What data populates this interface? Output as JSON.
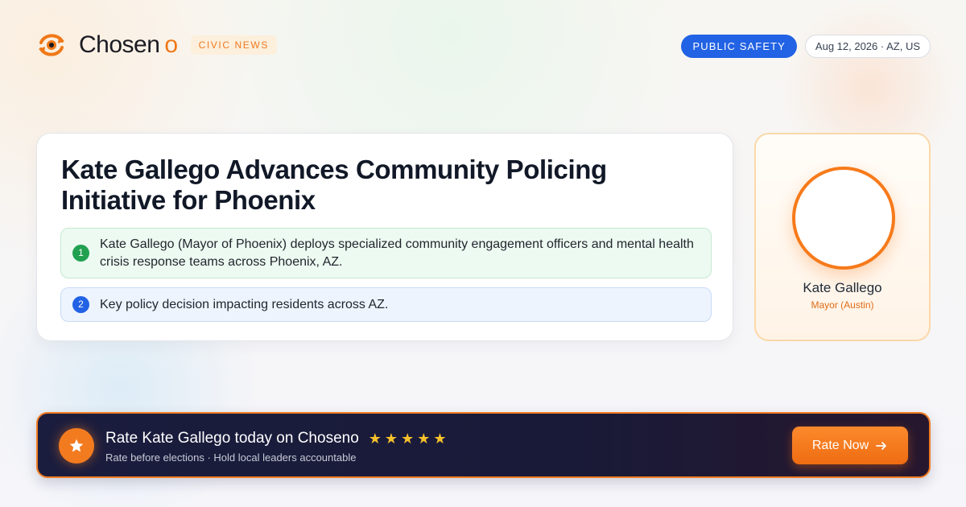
{
  "brand": {
    "name": "Chosen",
    "name_suffix": "o",
    "tag": "CIVIC NEWS",
    "logo_icon": "eye-refresh-icon"
  },
  "header": {
    "category": "PUBLIC SAFETY",
    "meta": "Aug 12, 2026 · AZ, US"
  },
  "article": {
    "headline": "Kate Gallego Advances Community Policing Initiative for Phoenix",
    "points": [
      {
        "number": "1",
        "text": "Kate Gallego (Mayor of Phoenix) deploys specialized community engagement officers and mental health crisis response teams across Phoenix, AZ."
      },
      {
        "number": "2",
        "text": "Key policy decision impacting residents across AZ."
      }
    ]
  },
  "profile": {
    "name": "Kate Gallego",
    "role": "Mayor (Austin)"
  },
  "cta": {
    "title": "Rate Kate Gallego today on Choseno",
    "stars": [
      "★",
      "★",
      "★",
      "★",
      "★"
    ],
    "subtitle": "Rate before elections · Hold local leaders accountable",
    "button_label": "Rate Now",
    "button_icon": "arrow-right-icon"
  },
  "colors": {
    "accent": "#f07818",
    "category_blue": "#2262e4",
    "point_green": "#21a150",
    "banner_dark": "#1b1d3e",
    "star_gold": "#f7c12c"
  }
}
